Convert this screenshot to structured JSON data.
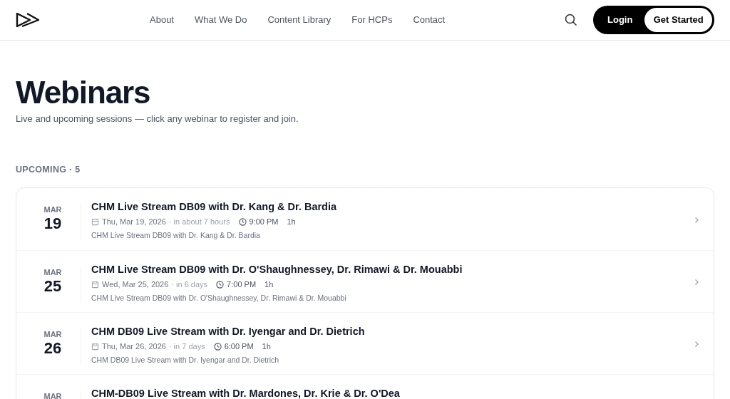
{
  "nav": {
    "links": [
      "About",
      "What We Do",
      "Content Library",
      "For HCPs",
      "Contact"
    ],
    "login": "Login",
    "get_started": "Get Started"
  },
  "page": {
    "title": "Webinars",
    "subtitle": "Live and upcoming sessions — click any webinar to register and join."
  },
  "section": {
    "label": "UPCOMING · 5"
  },
  "webinars": [
    {
      "month": "MAR",
      "day": "19",
      "title": "CHM Live Stream DB09 with Dr. Kang & Dr. Bardia",
      "date": "Thu, Mar 19, 2026",
      "relative": "· in about 7 hours",
      "time": "9:00 PM",
      "duration": "1h",
      "description": "CHM Live Stream DB09 with Dr. Kang & Dr. Bardia"
    },
    {
      "month": "MAR",
      "day": "25",
      "title": "CHM Live Stream DB09 with Dr. O'Shaughnessey, Dr. Rimawi & Dr. Mouabbi",
      "date": "Wed, Mar 25, 2026",
      "relative": "· in 6 days",
      "time": "7:00 PM",
      "duration": "1h",
      "description": "CHM Live Stream DB09 with Dr. O'Shaughnessey, Dr. Rimawi & Dr. Mouabbi"
    },
    {
      "month": "MAR",
      "day": "26",
      "title": "CHM DB09 Live Stream with Dr. Iyengar and Dr. Dietrich",
      "date": "Thu, Mar 26, 2026",
      "relative": "· in 7 days",
      "time": "6:00 PM",
      "duration": "1h",
      "description": "CHM DB09 Live Stream with Dr. Iyengar and Dr. Dietrich"
    },
    {
      "month": "MAR",
      "title": "CHM-DB09 Live Stream with Dr. Mardones, Dr. Krie & Dr. O'Dea"
    }
  ]
}
